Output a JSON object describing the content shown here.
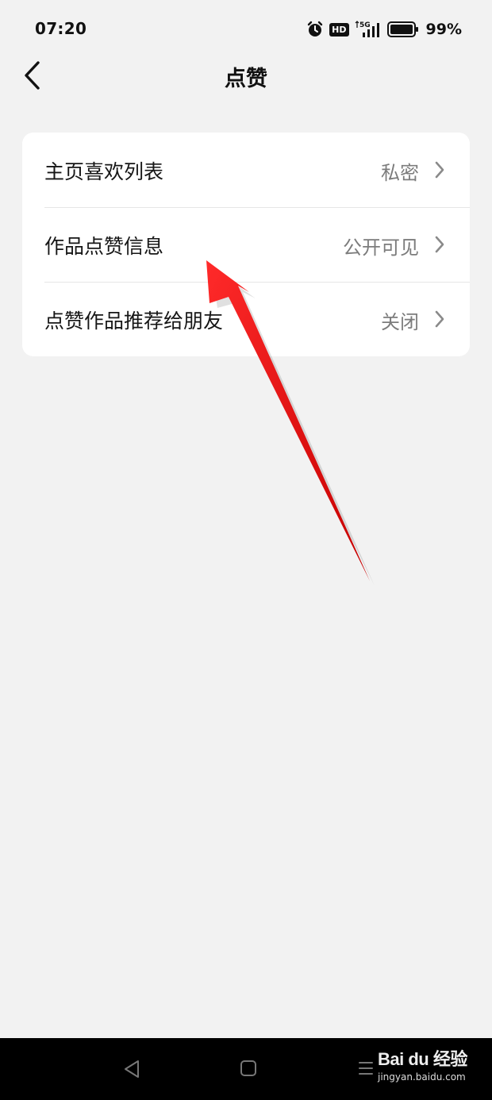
{
  "status_bar": {
    "time": "07:20",
    "hd_label": "HD",
    "network_label": "5G",
    "battery_percent": "99%",
    "icons": [
      "alarm-icon",
      "hd-icon",
      "signal-5g-icon",
      "battery-icon"
    ]
  },
  "header": {
    "title": "点赞",
    "back_icon": "chevron-left-icon"
  },
  "settings": {
    "items": [
      {
        "label": "主页喜欢列表",
        "value": "私密"
      },
      {
        "label": "作品点赞信息",
        "value": "公开可见"
      },
      {
        "label": "点赞作品推荐给朋友",
        "value": "关闭"
      }
    ]
  },
  "annotation": {
    "color": "#e8141c"
  },
  "nav_bar": {
    "icons": [
      "nav-back-icon",
      "nav-home-icon",
      "nav-menu-icon"
    ],
    "watermark_logo": "Bai du 经验",
    "watermark_url": "jingyan.baidu.com"
  }
}
